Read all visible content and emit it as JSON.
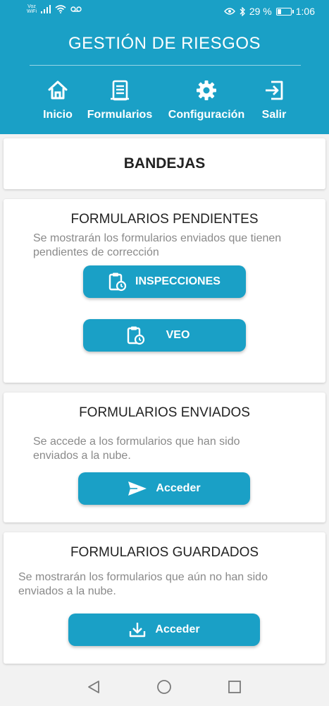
{
  "status_bar": {
    "vowifi_top": "Voz",
    "vowifi_bottom": "WiFi",
    "battery_percent": "29 %",
    "battery_level": 0.29,
    "time": "1:06"
  },
  "header": {
    "title": "GESTIÓN DE RIESGOS",
    "nav": [
      {
        "label": "Inicio",
        "icon": "home-icon"
      },
      {
        "label": "Formularios",
        "icon": "form-icon"
      },
      {
        "label": "Configuración",
        "icon": "gear-icon"
      },
      {
        "label": "Salir",
        "icon": "logout-icon"
      }
    ]
  },
  "bandejas": {
    "title": "BANDEJAS"
  },
  "pendientes": {
    "title": "FORMULARIOS PENDIENTES",
    "description": "Se mostrarán los formularios enviados que tienen pendientes de corrección",
    "buttons": [
      {
        "label": "INSPECCIONES",
        "icon": "clipboard-clock-icon"
      },
      {
        "label": "VEO",
        "icon": "clipboard-clock-icon"
      }
    ]
  },
  "enviados": {
    "title": "FORMULARIOS ENVIADOS",
    "description": "Se accede a los formularios que han sido enviados a la nube.",
    "button": {
      "label": "Acceder",
      "icon": "send-icon"
    }
  },
  "guardados": {
    "title": "FORMULARIOS GUARDADOS",
    "description": "Se mostrarán los formularios que aún no han sido enviados a la nube.",
    "button": {
      "label": "Acceder",
      "icon": "download-icon"
    }
  },
  "colors": {
    "accent": "#1aa0c6",
    "background": "#f2f2f2"
  }
}
